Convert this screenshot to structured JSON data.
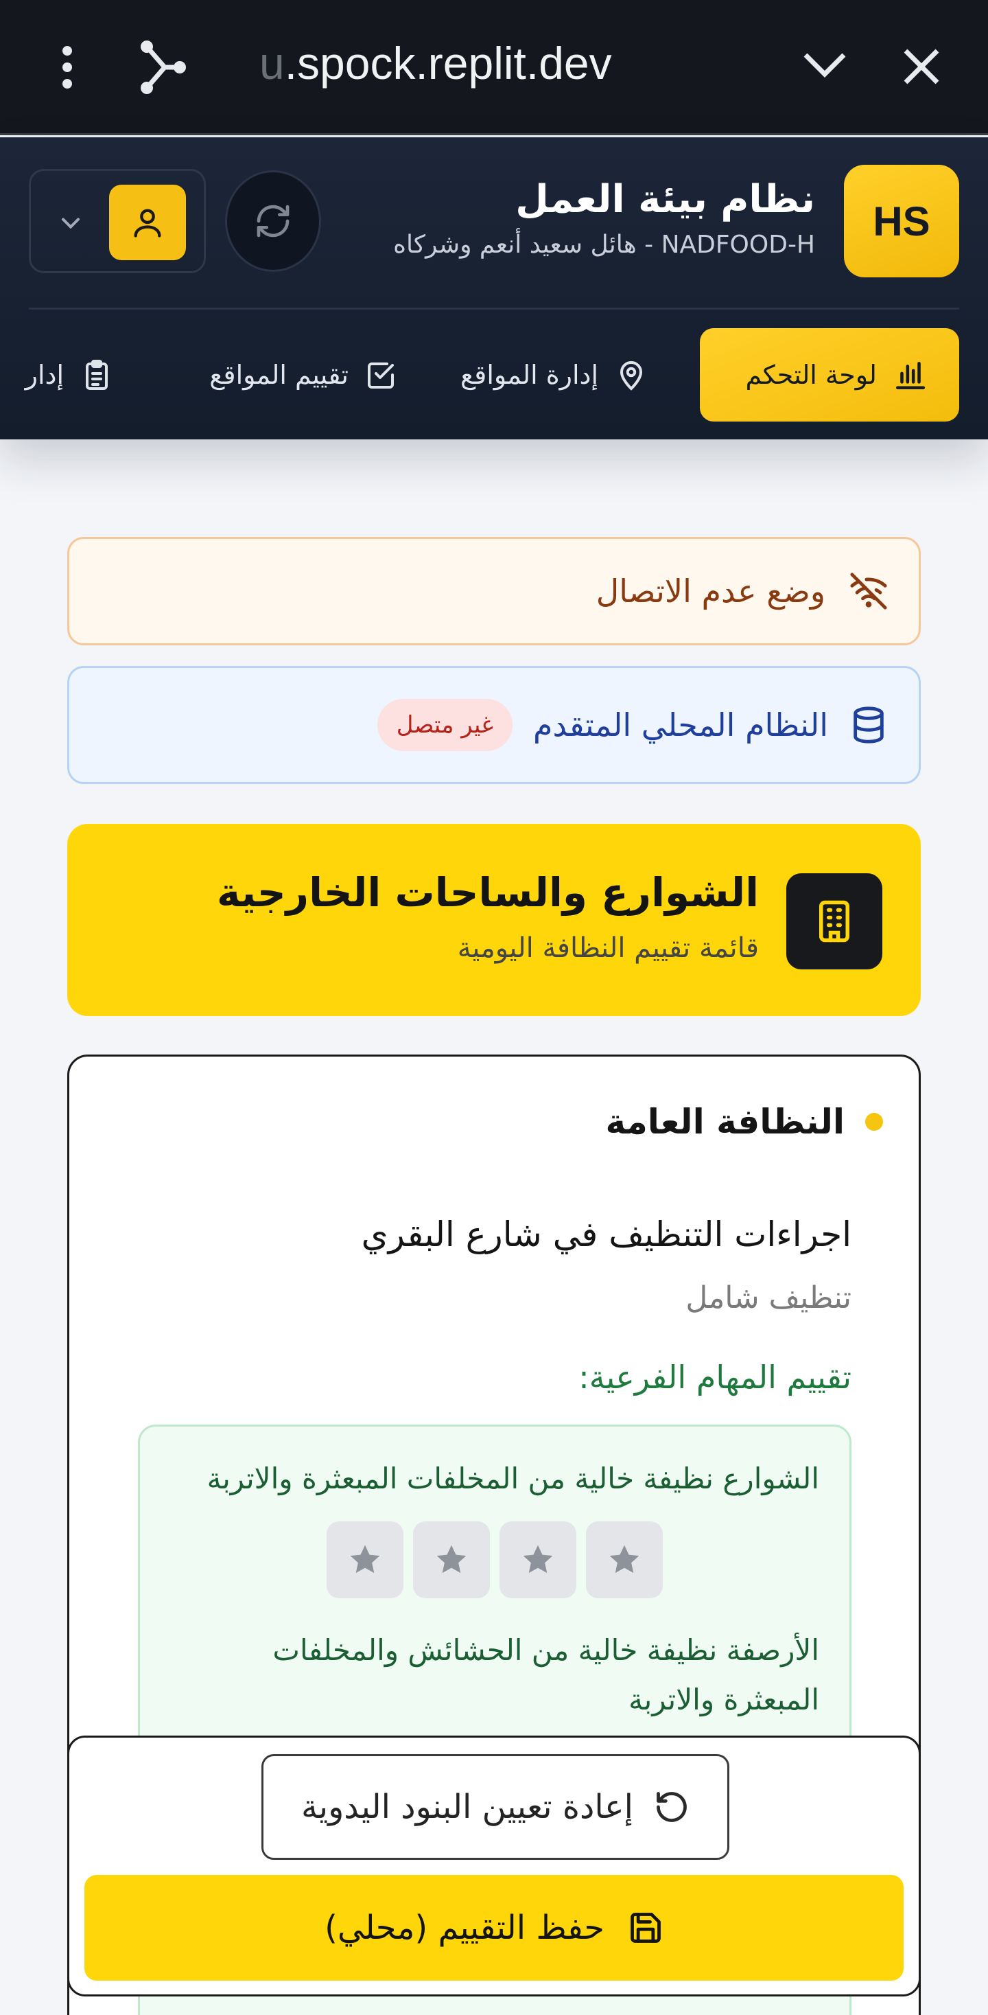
{
  "browser": {
    "url_faded": "u",
    "url": ".spock.replit.dev",
    "icons": [
      "more-vert-icon",
      "share-icon",
      "chevron-down-icon",
      "close-icon"
    ]
  },
  "header": {
    "logo_text": "HS",
    "title": "نظام بيئة العمل",
    "subtitle": "NADFOOD-H - هائل سعيد أنعم وشركاه"
  },
  "nav": {
    "tabs": [
      {
        "label": "لوحة التحكم",
        "icon": "bar-chart-icon",
        "active": true
      },
      {
        "label": "إدارة المواقع",
        "icon": "map-pin-icon",
        "active": false
      },
      {
        "label": "تقييم المواقع",
        "icon": "checkbox-icon",
        "active": false
      },
      {
        "label": "إدار",
        "icon": "clipboard-icon",
        "active": false
      }
    ]
  },
  "status": {
    "offline_text": "وضع عدم الاتصال",
    "local_system_text": "النظام المحلي المتقدم",
    "local_system_badge": "غير متصل"
  },
  "section": {
    "title": "الشوارع والساحات الخارجية",
    "subtitle": "قائمة تقييم النظافة اليومية"
  },
  "evaluation": {
    "category": "النظافة العامة",
    "item_title": "اجراءات التنظيف في شارع البقري",
    "item_subtitle": "تنظيف شامل",
    "subtasks_label": "تقييم المهام الفرعية:",
    "subtasks": [
      {
        "text": "الشوارع نظيفة خالية من المخلفات المبعثرة والاتربة",
        "rating": 0,
        "max": 4
      },
      {
        "text": "الأرصفة نظيفة خالية من الحشائش والمخلفات المبعثرة والاتربة",
        "rating": 0,
        "max": 4
      }
    ]
  },
  "actions": {
    "reset_label": "إعادة تعيين البنود اليدوية",
    "save_label": "حفظ التقييم (محلي)"
  },
  "colors": {
    "accent": "#ffd60a",
    "header_bg": "#1c2638",
    "offline": "#8a3a10",
    "local": "#1f3f9a",
    "success": "#1f7a3f"
  }
}
